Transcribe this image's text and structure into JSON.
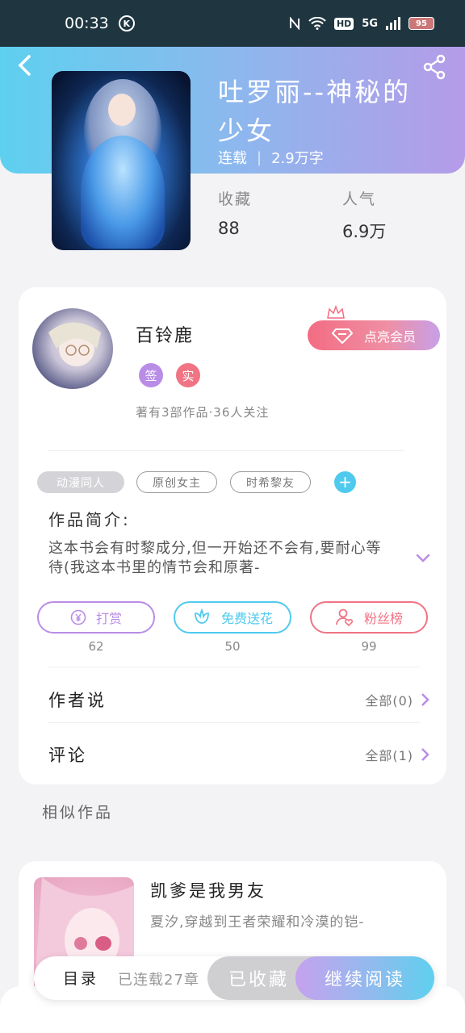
{
  "status_bar": {
    "time": "00:33",
    "k_badge": "K",
    "network": "5G",
    "hd": "HD",
    "battery": "95"
  },
  "book": {
    "title": "吐罗丽--神秘的少女",
    "status": "连载",
    "word_count": "2.9万字",
    "stats": [
      {
        "label": "收藏",
        "value": "88"
      },
      {
        "label": "人气",
        "value": "6.9万"
      }
    ]
  },
  "author": {
    "name": "百铃鹿",
    "badges": [
      {
        "text": "签",
        "color": "#b98de6"
      },
      {
        "text": "实",
        "color": "#f07484"
      }
    ],
    "vip_button": "点亮会员",
    "summary": "著有3部作品·36人关注"
  },
  "tags": [
    "动漫同人",
    "原创女主",
    "时希黎友"
  ],
  "intro": {
    "title": "作品简介:",
    "text": "这本书会有时黎成分,但一开始还不会有,要耐心等待(我这本书里的情节会和原著-"
  },
  "actions": [
    {
      "label": "打赏",
      "count": "62",
      "color": "#b98de6",
      "icon": "yuan-icon"
    },
    {
      "label": "免费送花",
      "count": "50",
      "color": "#4fcaee",
      "icon": "flower-icon"
    },
    {
      "label": "粉丝榜",
      "count": "99",
      "color": "#f07484",
      "icon": "fans-icon"
    }
  ],
  "rows": [
    {
      "label": "作者说",
      "right": "全部(0)"
    },
    {
      "label": "评论",
      "right": "全部(1)"
    }
  ],
  "similar": {
    "section_title": "相似作品",
    "items": [
      {
        "title": "凯爹是我男友",
        "desc": "夏汐,穿越到王者荣耀和冷漠的铠-"
      }
    ]
  },
  "bottom": {
    "toc": "目录",
    "chapter_status": "已连载27章",
    "collected": "已收藏",
    "continue": "继续阅读"
  }
}
